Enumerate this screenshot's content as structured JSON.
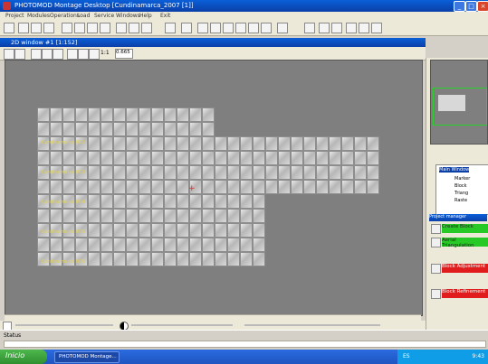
{
  "window": {
    "title": "PHOTOMOD Montage Desktop [Cundinamarca_2007 [1]]",
    "controls": [
      "_",
      "□",
      "×"
    ]
  },
  "menu": {
    "items": [
      "Project",
      "Modules",
      "Operations",
      "Load",
      "Service",
      "Windows",
      "Help",
      "Exit"
    ]
  },
  "panel": {
    "title": "2D window #1 [1:152]",
    "zoom_value": "0.665",
    "zoom_label": "1:1"
  },
  "canvas": {
    "strip_labels": [
      "Cundinamarca 002",
      "Cundinamarca 003",
      "Cundinamarca 004",
      "Cundinamarca 005",
      "Cundinamarca 006"
    ]
  },
  "tree": {
    "root": "Main Window",
    "items": [
      "Marker",
      "Block",
      "Triang",
      "Raste"
    ]
  },
  "project_manager": {
    "title": "Project manager",
    "buttons": [
      "Create Block",
      "Aerial Triangulation",
      "Block Adjustment",
      "Block Refinement"
    ]
  },
  "status": {
    "label": "Status",
    "text": ""
  },
  "taskbar": {
    "start_label": "Inicio",
    "task_label": "PHOTOMOD Montage...",
    "language": "ES",
    "time": "9:43"
  }
}
